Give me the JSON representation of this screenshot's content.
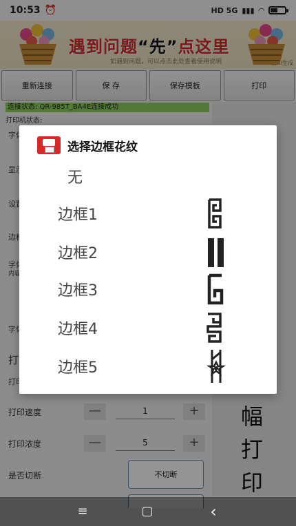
{
  "status_bar": {
    "time": "10:53",
    "network": "HD 5G"
  },
  "banner": {
    "title_prefix": "遇到问题",
    "title_emph": "“先”",
    "title_suffix": "点这里",
    "subtitle": "如遇到问题，可以点击此处查看使用说明",
    "corner": "由AI生成"
  },
  "toolbar": {
    "buttons": [
      "重新连接",
      "保 存",
      "保存模板",
      "打印"
    ]
  },
  "connection_status": "连接状态: QR-985T_BA4E连接成功",
  "printer_status": "打印机状态:",
  "background_labels": [
    "字体",
    "显示",
    "设置",
    "边框",
    "字体",
    "内容",
    "字体",
    "打印",
    "打印"
  ],
  "form": {
    "speed_label": "打印速度",
    "speed_value": "1",
    "density_label": "打印浓度",
    "density_value": "5",
    "cut_label": "是否切断",
    "cut_value": "不切断",
    "minus_icon": "—",
    "plus_icon": "+"
  },
  "side_preview": {
    "lines": [
      "幅",
      "打",
      "印"
    ]
  },
  "dialog": {
    "title": "选择边框花纹",
    "options": [
      {
        "label": "无",
        "pattern": "none"
      },
      {
        "label": "边框1",
        "pattern": "spiral-icon"
      },
      {
        "label": "边框2",
        "pattern": "double-bar-icon"
      },
      {
        "label": "边框3",
        "pattern": "hook-icon"
      },
      {
        "label": "边框4",
        "pattern": "meander-icon"
      },
      {
        "label": "边框5",
        "pattern": "star-ornament-icon"
      }
    ]
  },
  "nav": {
    "menu": "≡",
    "home": "▢",
    "back": "‹"
  },
  "colors": {
    "connection_bg": "#8dd35d",
    "banner_title": "#d42b2b",
    "dialog_icon": "#d62a2a"
  }
}
